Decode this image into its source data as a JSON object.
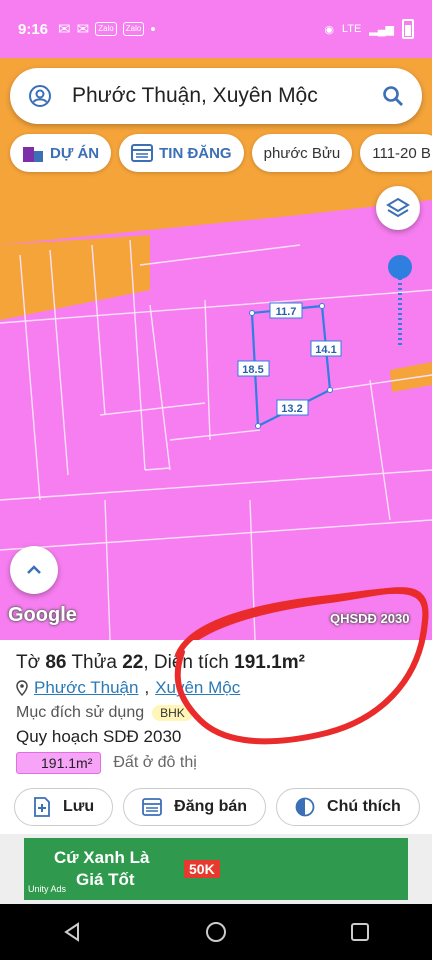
{
  "status": {
    "time": "9:16",
    "apps": [
      "Zalo",
      "Zalo"
    ],
    "net": "LTE"
  },
  "search": {
    "query": "Phước Thuận, Xuyên Mộc"
  },
  "chips": [
    "DỰ ÁN",
    "TIN ĐĂNG",
    "phước Bửu",
    "111-20 B"
  ],
  "map": {
    "labels": [
      "11.7",
      "14.1",
      "18.5",
      "13.2"
    ],
    "logo": "Google",
    "layer_tag": "QHSDĐ 2030",
    "colors": {
      "land": "#f67ef0",
      "road": "#f5a43a"
    }
  },
  "parcel": {
    "sheet_label": "Tờ",
    "sheet_no": "86",
    "lot_label": "Thửa",
    "lot_no": "22",
    "area_label": "Diện tích",
    "area": "191.1m²",
    "ward": "Phước Thuận",
    "district": "Xuyên Mộc",
    "purpose_label": "Mục đích sử dụng",
    "purpose_badge": "BHK",
    "plan_title": "Quy hoạch SDĐ 2030",
    "plan_area": "191.1m²",
    "plan_type": "Đất ở đô thị"
  },
  "actions": [
    "Lưu",
    "Đăng bán",
    "Chú thích"
  ],
  "ad": {
    "line1": "Cứ Xanh Là",
    "line2": "Giá Tốt",
    "promo": "50K",
    "brand": "Unity Ads"
  }
}
